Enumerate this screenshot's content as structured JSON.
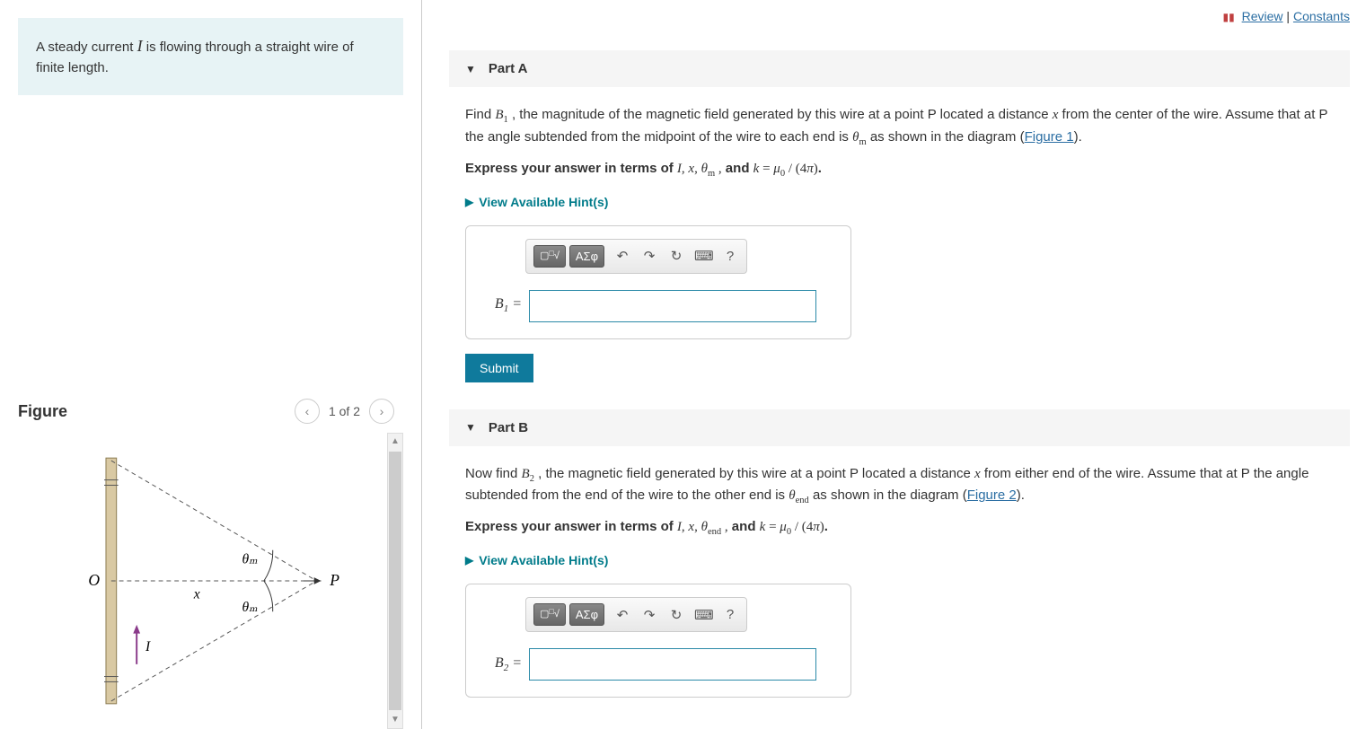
{
  "problem_intro": "A steady current I is flowing through a straight wire of finite length.",
  "top_links": {
    "review": "Review",
    "constants": "Constants"
  },
  "figure": {
    "title": "Figure",
    "pager": "1 of 2",
    "labels": {
      "O": "O",
      "x": "x",
      "P": "P",
      "I": "I",
      "theta_m": "θₘ"
    }
  },
  "partA": {
    "title": "Part A",
    "text_prefix": "Find ",
    "text_var": "B₁",
    "text_mid": " , the magnitude of the magnetic field generated by this wire at a point P located a distance ",
    "text_x": "x",
    "text_after_x": " from the center of the wire. Assume that at P the angle subtended from the midpoint of the wire to each end is ",
    "text_theta": "θₘ",
    "text_end": " as shown in the diagram (",
    "figure_link": "Figure 1",
    "text_close": ").",
    "express": "Express your answer in terms of I, x, θₘ , and k = μ₀ / (4π).",
    "hints": "View Available Hint(s)",
    "answer_label": "B₁ =",
    "submit": "Submit"
  },
  "partB": {
    "title": "Part B",
    "text_prefix": "Now find ",
    "text_var": "B₂",
    "text_mid": " , the magnetic field generated by this wire at a point P located a distance ",
    "text_x": "x",
    "text_after_x": " from either end of the wire. Assume that at P the angle subtended from the end of the wire to the other end is ",
    "text_theta": "θₑₙ𝒹",
    "text_end": " as shown in the diagram (",
    "figure_link": "Figure 2",
    "text_close": ").",
    "express": "Express your answer in terms of I, x, θₑₙ𝒹 , and k = μ₀ / (4π).",
    "hints": "View Available Hint(s)",
    "answer_label": "B₂ ="
  },
  "toolbar": {
    "templates": "▢√▢",
    "greek": "ΑΣφ",
    "help": "?"
  }
}
